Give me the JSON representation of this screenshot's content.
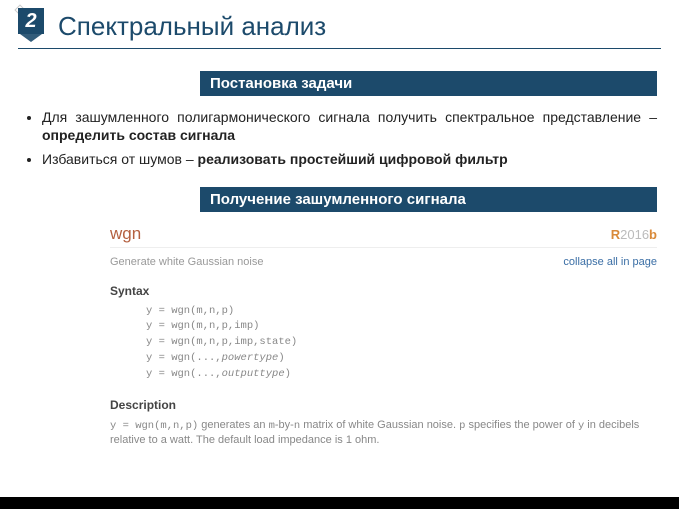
{
  "page_number": "2",
  "title": "Спектральный анализ",
  "sections": {
    "problem": "Постановка задачи",
    "noisy": "Получение зашумленного сигнала"
  },
  "bullets": [
    {
      "pre": "Для зашумленного полигармонического сигнала получить спектральное представление – ",
      "bold": "определить состав сигнала"
    },
    {
      "pre": "Избавиться от шумов – ",
      "bold": "реализовать простейший цифровой фильтр"
    }
  ],
  "doc": {
    "fn": "wgn",
    "ver_r": "R",
    "ver_year": "2016",
    "ver_b": "b",
    "subtitle": "Generate white Gaussian noise",
    "collapse": "collapse all in page",
    "syntax_h": "Syntax",
    "code": [
      "y = wgn(m,n,p)",
      "y = wgn(m,n,p,imp)",
      "y = wgn(m,n,p,imp,state)"
    ],
    "code4_a": "y = wgn(...,",
    "code4_b": "powertype",
    "code4_c": ")",
    "code5_a": "y = wgn(...,",
    "code5_b": "outputtype",
    "code5_c": ")",
    "desc_h": "Description",
    "desc_1": "y = wgn(m,n,p)",
    "desc_2": " generates an ",
    "desc_3": "m",
    "desc_4": "-by-",
    "desc_5": "n",
    "desc_6": " matrix of white Gaussian noise. ",
    "desc_7": "p",
    "desc_8": " specifies the power of ",
    "desc_9": "y",
    "desc_10": " in decibels relative to a watt. The default load impedance is 1 ohm."
  }
}
